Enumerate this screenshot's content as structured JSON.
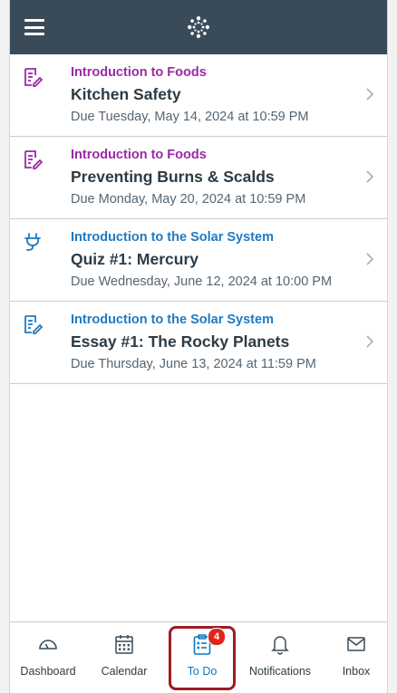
{
  "colors": {
    "topbar": "#394b58",
    "foods_course": "#9b29a8",
    "solar_course": "#1f7ac1",
    "active_tab": "#0b78c4",
    "highlight": "#9e1b24",
    "badge": "#e0251f"
  },
  "header": {
    "menu_icon": "hamburger-icon",
    "logo_icon": "canvas-logo-icon"
  },
  "todo": {
    "items": [
      {
        "icon": "assignment-icon",
        "course": "Introduction to Foods",
        "title": "Kitchen Safety",
        "due": "Due Tuesday, May 14, 2024 at 10:59 PM"
      },
      {
        "icon": "assignment-icon",
        "course": "Introduction to Foods",
        "title": "Preventing Burns & Scalds",
        "due": "Due Monday, May 20, 2024 at 10:59 PM"
      },
      {
        "icon": "quiz-icon",
        "course": "Introduction to the Solar System",
        "title": "Quiz #1: Mercury",
        "due": "Due Wednesday, June 12, 2024 at 10:00 PM"
      },
      {
        "icon": "assignment-icon",
        "course": "Introduction to the Solar System",
        "title": "Essay #1: The Rocky Planets",
        "due": "Due Thursday, June 13, 2024 at 11:59 PM"
      }
    ]
  },
  "tabbar": {
    "tabs": [
      {
        "label": "Dashboard",
        "icon": "dashboard-icon"
      },
      {
        "label": "Calendar",
        "icon": "calendar-icon"
      },
      {
        "label": "To Do",
        "icon": "todo-icon",
        "badge": "4",
        "active": true
      },
      {
        "label": "Notifications",
        "icon": "bell-icon"
      },
      {
        "label": "Inbox",
        "icon": "envelope-icon"
      }
    ]
  }
}
